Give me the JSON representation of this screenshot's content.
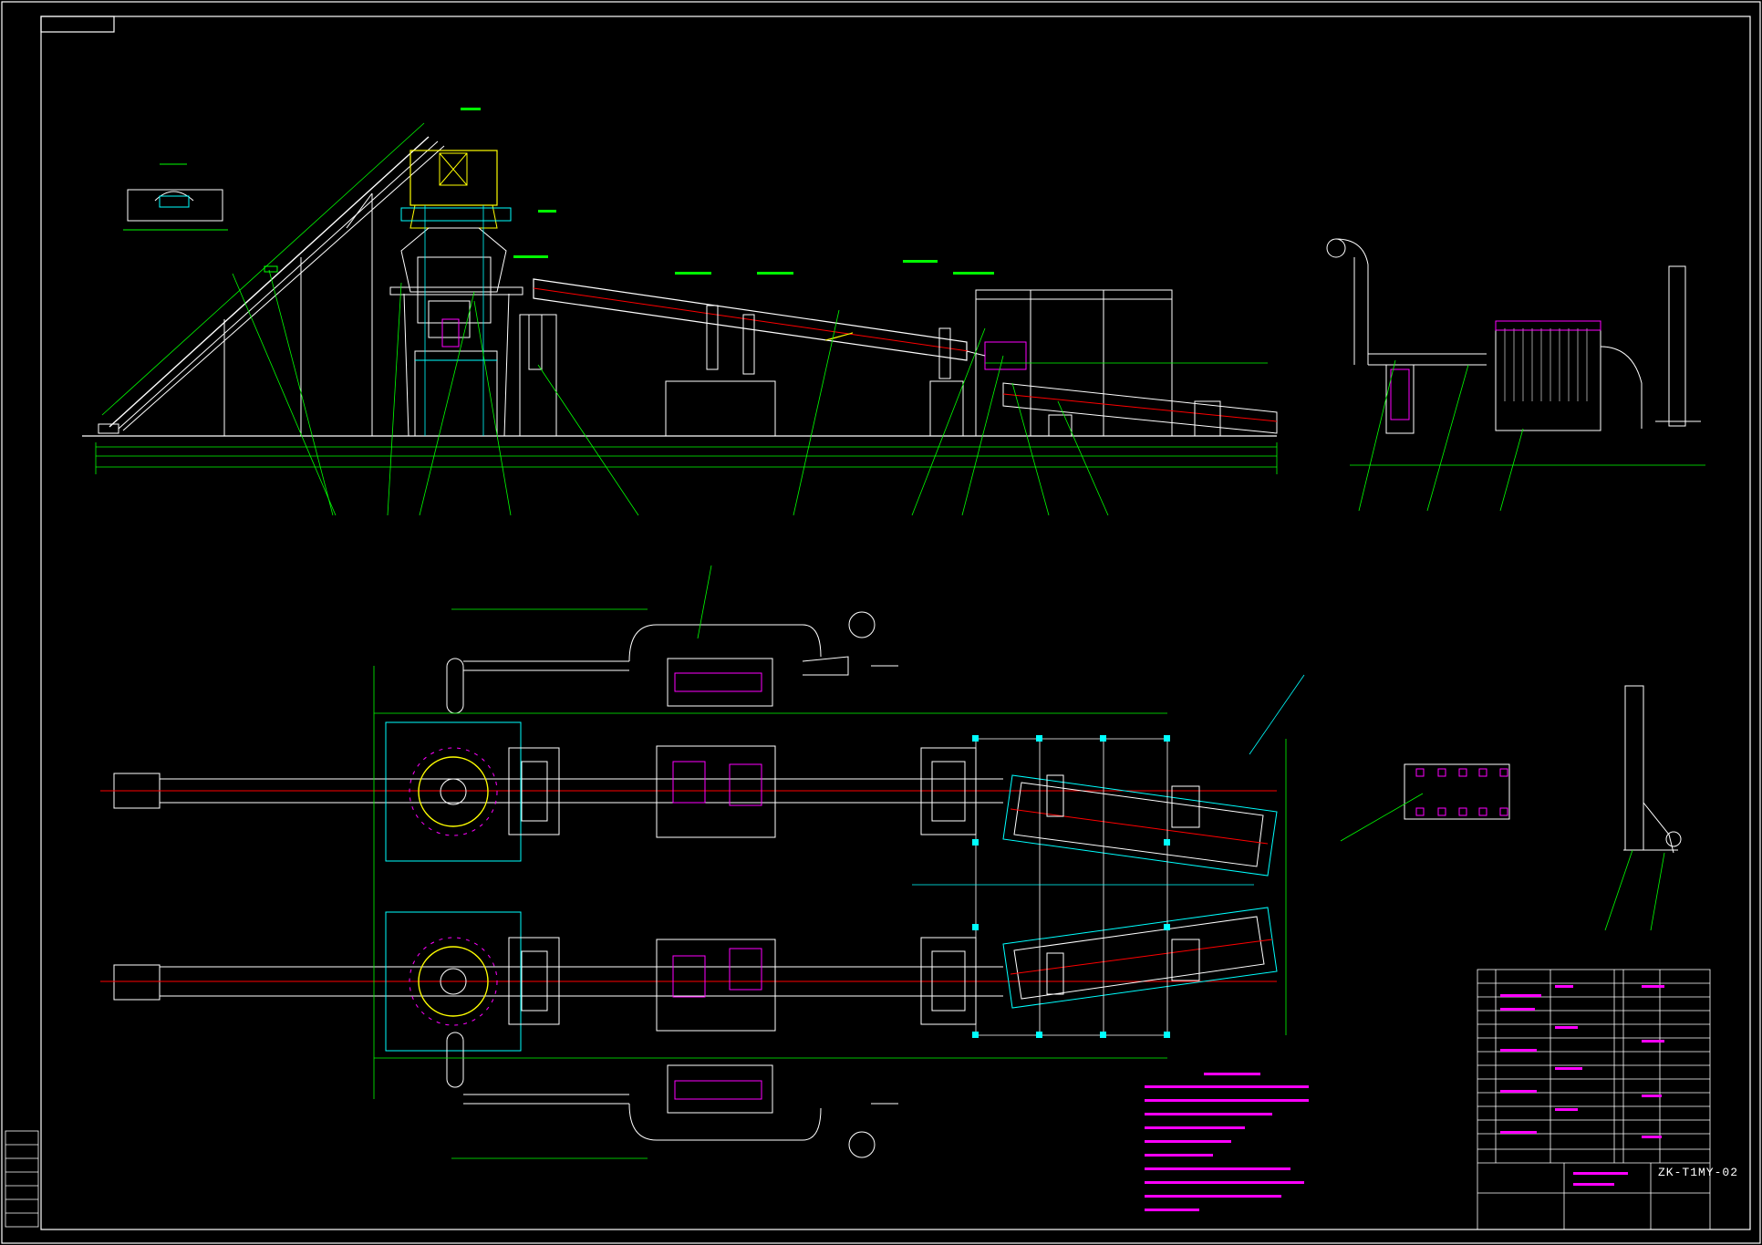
{
  "drawing": {
    "number": "ZK-T1MY-02",
    "background": "#000000",
    "colors": {
      "frame": "#ffffff",
      "dimension": "#00ff00",
      "centerline": "#ff0000",
      "annotation": "#ff00ff",
      "hopper": "#ffff00",
      "leader": "#00ffff"
    },
    "icons": [
      "frame-border",
      "conveyor",
      "rotary-kiln",
      "dust-collector",
      "stack",
      "cyclone",
      "plan-view",
      "title-block"
    ]
  }
}
